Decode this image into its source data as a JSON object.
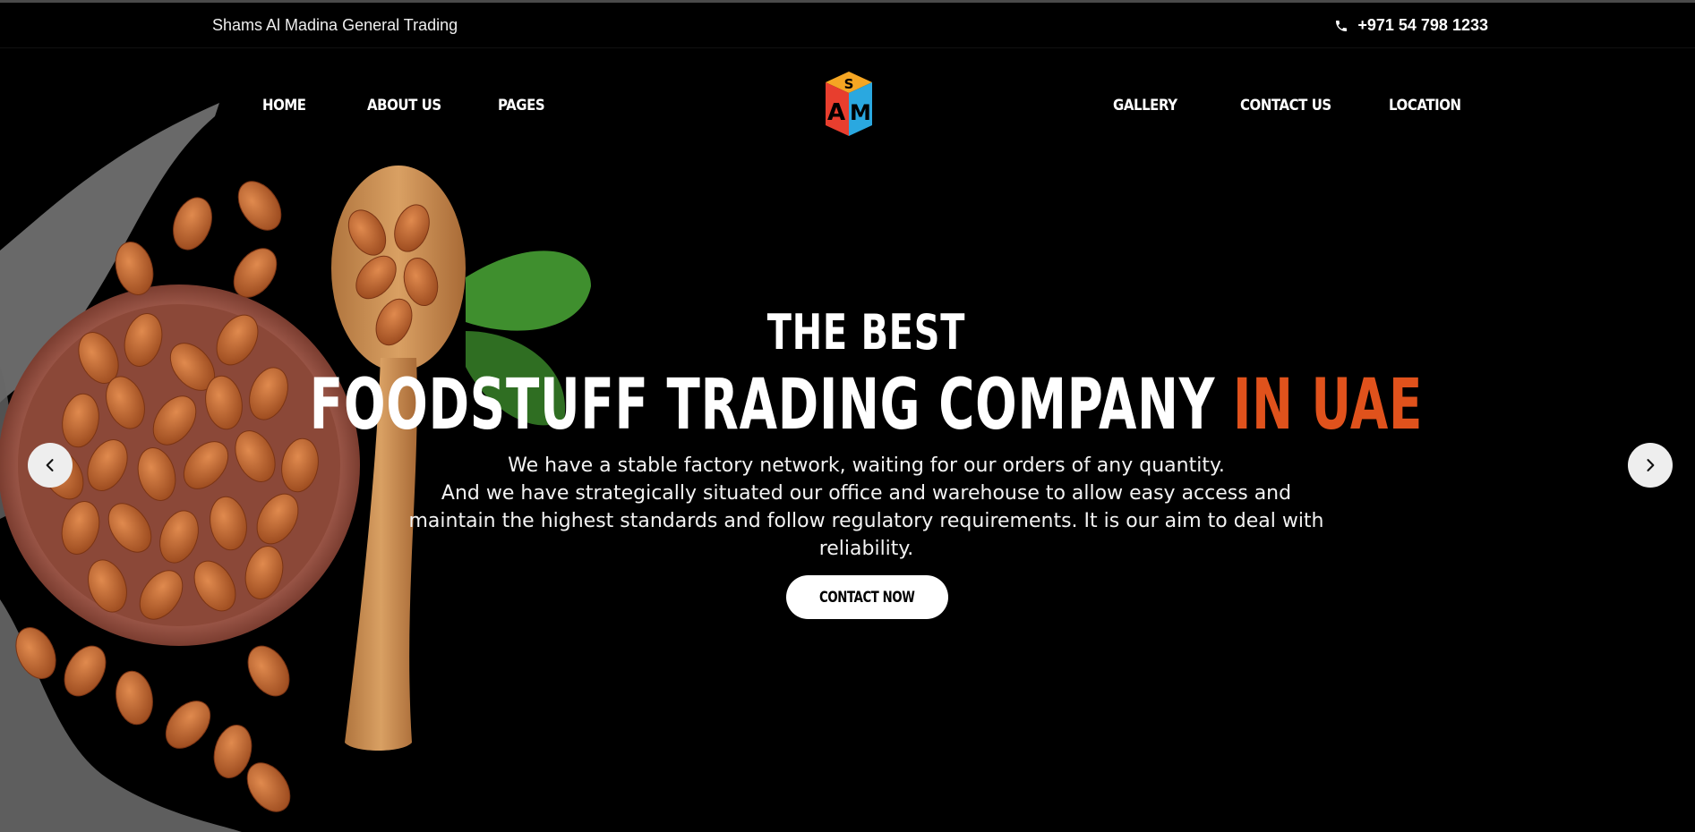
{
  "topbar": {
    "company_name": "Shams Al Madina General Trading",
    "phone": "+971 54 798 1233",
    "phone_icon": "phone-icon"
  },
  "nav": {
    "left": [
      "HOME",
      "ABOUT US",
      "PAGES"
    ],
    "right": [
      "GALLERY",
      "CONTACT US",
      "LOCATION"
    ],
    "logo_letters": [
      "S",
      "A",
      "M"
    ]
  },
  "hero": {
    "headline_top": "THE BEST",
    "headline_main": "FOODSTUFF TRADING COMPANY",
    "headline_accent": "IN UAE",
    "description_lines": [
      "We have a stable factory network, waiting for our orders of any quantity.",
      "And we have strategically situated our office and warehouse to allow easy access and",
      "maintain the highest standards and follow regulatory requirements. It is our aim to deal with reliability."
    ],
    "cta_label": "CONTACT NOW",
    "prev_icon": "chevron-left-icon",
    "next_icon": "chevron-right-icon"
  },
  "colors": {
    "background": "#000000",
    "accent": "#e0521c",
    "logo_orange": "#f5a623",
    "logo_red": "#e83e2e",
    "logo_blue": "#2aa8e0"
  }
}
